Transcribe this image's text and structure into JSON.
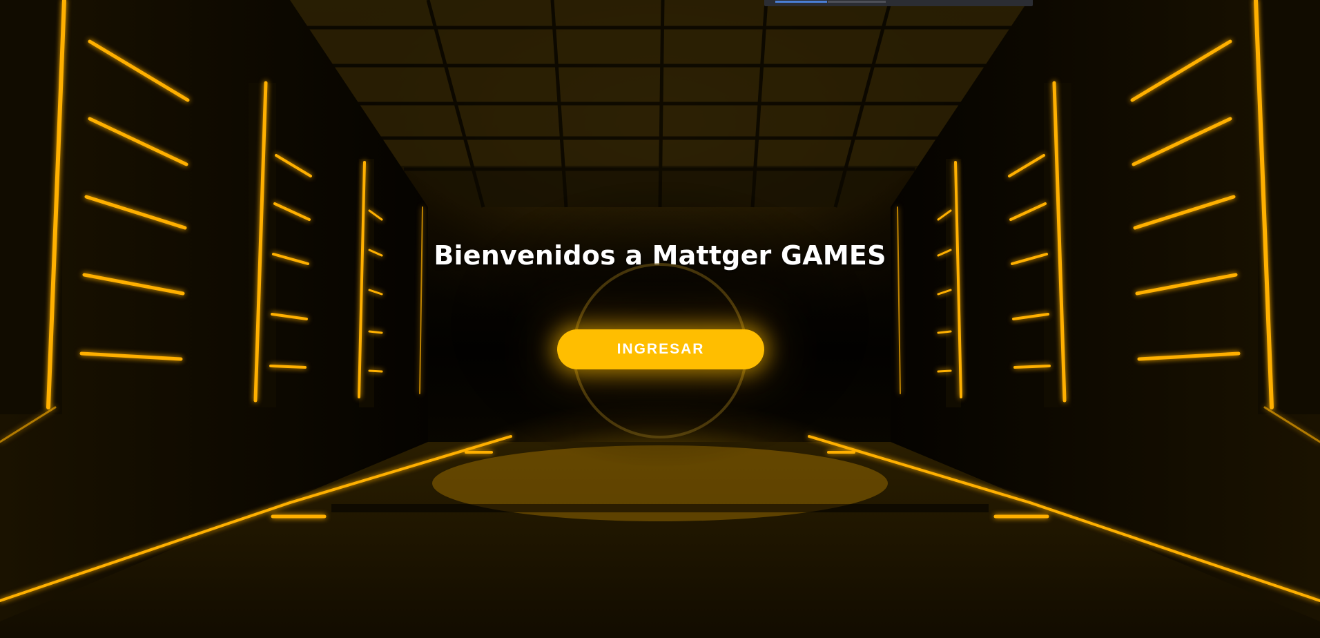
{
  "page": {
    "welcome_title": "Bienvenidos a Mattger GAMES",
    "enter_button_label": "INGRESAR"
  },
  "colors": {
    "accent": "#ffbe00",
    "neon": "#ffb000",
    "background": "#050300",
    "title_text": "#ffffff"
  },
  "decor": {
    "background_scene": "neon-corridor",
    "focus_ring": "ring-outline"
  }
}
